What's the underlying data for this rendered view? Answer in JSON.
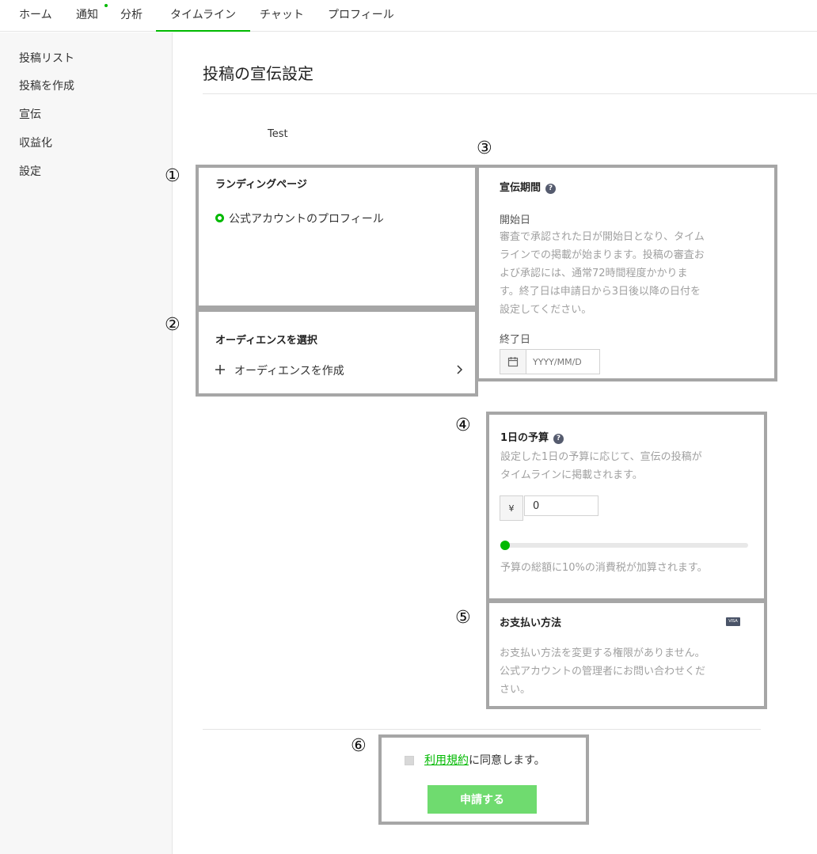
{
  "colors": {
    "accent": "#00b900",
    "annotation_border": "#a6a6a6",
    "submit_bg": "#6fdb6f"
  },
  "topnav": {
    "tabs": [
      {
        "label": "ホーム"
      },
      {
        "label": "通知"
      },
      {
        "label": "分析"
      },
      {
        "label": "タイムライン",
        "active": true
      },
      {
        "label": "チャット"
      },
      {
        "label": "プロフィール"
      }
    ]
  },
  "sidebar": {
    "items": [
      {
        "label": "投稿リスト"
      },
      {
        "label": "投稿を作成"
      },
      {
        "label": "宣伝"
      },
      {
        "label": "収益化"
      },
      {
        "label": "設定"
      }
    ]
  },
  "page": {
    "title": "投稿の宣伝設定",
    "post_name": "Test"
  },
  "annotations": [
    "①",
    "②",
    "③",
    "④",
    "⑤",
    "⑥"
  ],
  "landing": {
    "title": "ランディングページ",
    "option": "公式アカウントのプロフィール"
  },
  "audience": {
    "title": "オーディエンスを選択",
    "create": "オーディエンスを作成",
    "plus_icon": "plus-icon",
    "chevron": "chevron-right-icon"
  },
  "period": {
    "title": "宣伝期間",
    "help": "?",
    "start_label": "開始日",
    "start_lines": [
      "審査で承認された日が開始日となり、タイム",
      "ラインでの掲載が始まります。投稿の審査お",
      "よび承認には、通常72時間程度かかりま",
      "す。終了日は申請日から3日後以降の日付を",
      "設定してください。"
    ],
    "end_label": "終了日",
    "end_placeholder": "YYYY/MM/D"
  },
  "budget": {
    "title": "1日の予算",
    "help": "?",
    "desc_lines": [
      "設定した1日の予算に応じて、宣伝の投稿が",
      "タイムラインに掲載されます。"
    ],
    "currency": "¥",
    "value": "0",
    "slider_level": 0,
    "tax_note": "予算の総額に10%の消費税が加算されます。"
  },
  "payment": {
    "title": "お支払い方法",
    "card_brand": "VISA",
    "desc_lines": [
      "お支払い方法を変更する権限がありません。",
      "公式アカウントの管理者にお問い合わせくだ",
      "さい。"
    ]
  },
  "agreement": {
    "terms_link": "利用規約",
    "suffix": "に同意します。",
    "submit": "申請する"
  }
}
